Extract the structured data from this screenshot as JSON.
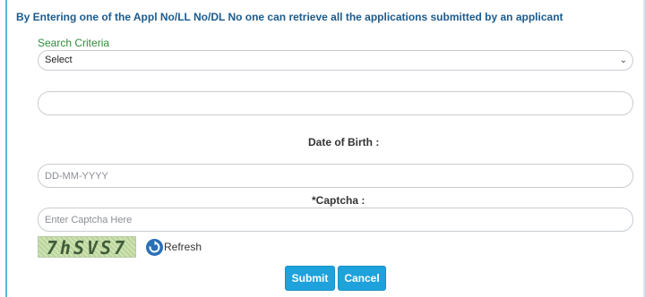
{
  "info_text": "By Entering one of the Appl No/LL No/DL No one can retrieve all the applications submitted by an applicant",
  "search_criteria": {
    "label": "Search Criteria",
    "selected": "Select"
  },
  "appl_input": {
    "value": ""
  },
  "dob": {
    "label": "Date of Birth :",
    "placeholder": "DD-MM-YYYY"
  },
  "captcha": {
    "label": "*Captcha :",
    "placeholder": "Enter Captcha Here",
    "image_text": "7hSVS7",
    "refresh_label": "Refresh"
  },
  "buttons": {
    "submit": "Submit",
    "cancel": "Cancel"
  },
  "colors": {
    "primary_button": "#1ea2dc",
    "info_text": "#1c5b8c",
    "criteria_label": "#2e8b3a"
  }
}
